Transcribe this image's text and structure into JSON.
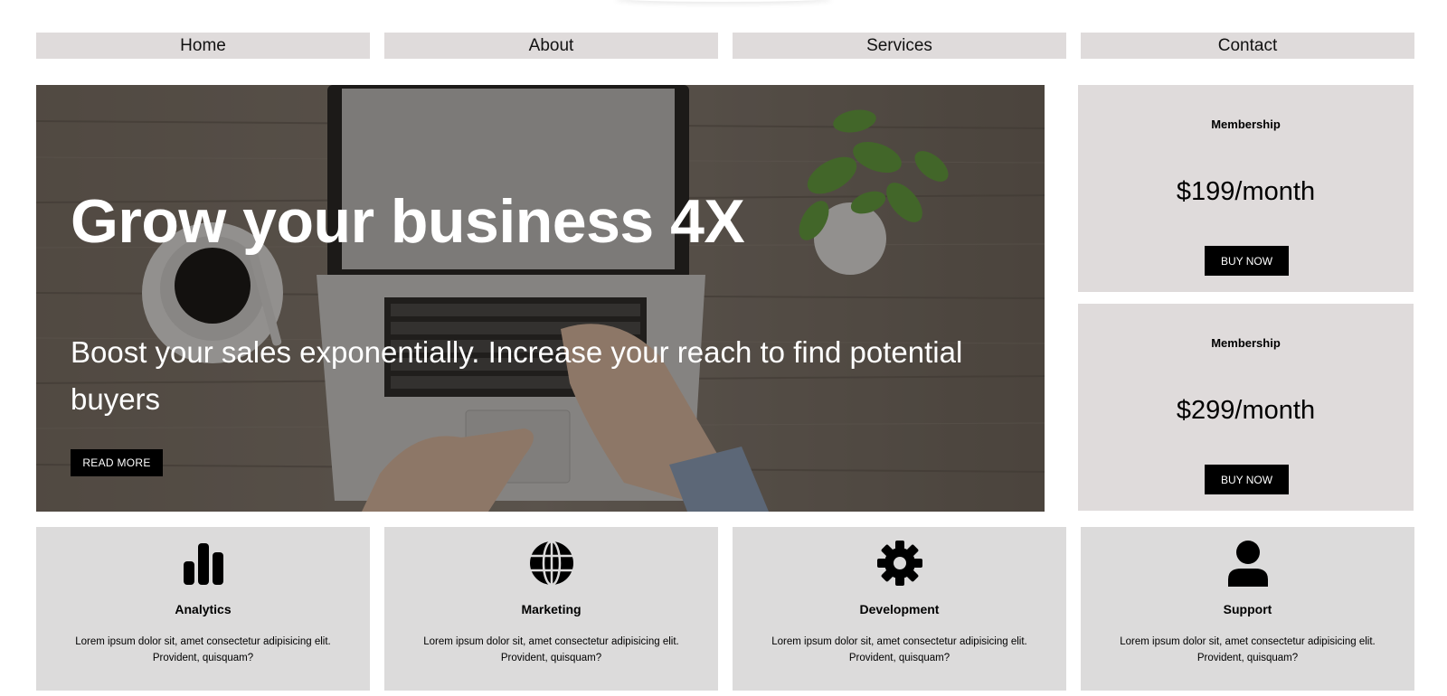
{
  "nav": {
    "items": [
      "Home",
      "About",
      "Services",
      "Contact"
    ]
  },
  "hero": {
    "title": "Grow your business 4X",
    "subtitle": "Boost your sales exponentially. Increase your reach to find potential buyers",
    "cta_label": "READ MORE"
  },
  "plans": [
    {
      "label": "Membership",
      "price": "$199/month",
      "button_label": "BUY NOW"
    },
    {
      "label": "Membership",
      "price": "$299/month",
      "button_label": "BUY NOW"
    }
  ],
  "features": [
    {
      "icon": "bar-chart-icon",
      "title": "Analytics",
      "text": "Lorem ipsum dolor sit, amet consectetur adipisicing elit. Provident, quisquam?"
    },
    {
      "icon": "globe-icon",
      "title": "Marketing",
      "text": "Lorem ipsum dolor sit, amet consectetur adipisicing elit. Provident, quisquam?"
    },
    {
      "icon": "gear-icon",
      "title": "Development",
      "text": "Lorem ipsum dolor sit, amet consectetur adipisicing elit. Provident, quisquam?"
    },
    {
      "icon": "user-icon",
      "title": "Support",
      "text": "Lorem ipsum dolor sit, amet consectetur adipisicing elit. Provident, quisquam?"
    }
  ],
  "colors": {
    "card_background": "#dfdbdb",
    "button_background": "#000000",
    "hero_text": "#ffffff"
  }
}
